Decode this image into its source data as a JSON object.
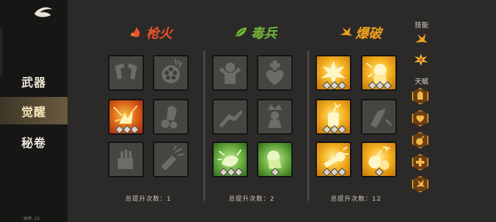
{
  "sidebar": {
    "items": [
      {
        "label": "武器",
        "active": false
      },
      {
        "label": "觉醒",
        "active": true
      },
      {
        "label": "秘卷",
        "active": false
      }
    ],
    "fps_label": "帧率: 25"
  },
  "columns": [
    {
      "title": "枪火",
      "icon": "flame-icon",
      "color": "#e8532a",
      "total_label": "总提升次数：1",
      "tiles": [
        "locked",
        "locked",
        "red",
        "locked",
        "locked",
        "locked"
      ]
    },
    {
      "title": "毒兵",
      "icon": "leaf-icon",
      "color": "#72b83c",
      "total_label": "总提升次数：2",
      "tiles": [
        "locked",
        "locked",
        "locked",
        "locked",
        "green",
        "green"
      ]
    },
    {
      "title": "爆破",
      "icon": "spark-icon",
      "color": "#f0a020",
      "total_label": "总提升次数：12",
      "tiles": [
        "gold",
        "gold",
        "gold",
        "locked",
        "gold",
        "gold"
      ]
    }
  ],
  "right_panel": {
    "skills_label": "技能",
    "talents_label": "天赋",
    "skill_icons": [
      "spark-skill-icon",
      "burst-skill-icon"
    ],
    "talent_icons": [
      "gear-talent-icon",
      "heart-talent-icon",
      "bomb-talent-icon",
      "plus-talent-icon",
      "spark-talent-icon"
    ]
  },
  "colors": {
    "accent": "#f0a020",
    "fire": "#e8532a",
    "poison": "#72b83c"
  }
}
